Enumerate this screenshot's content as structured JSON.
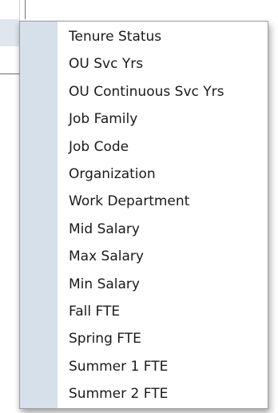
{
  "menu": {
    "items": [
      {
        "label": "Tenure Status"
      },
      {
        "label": "OU Svc Yrs"
      },
      {
        "label": "OU Continuous Svc Yrs"
      },
      {
        "label": "Job Family"
      },
      {
        "label": "Job Code"
      },
      {
        "label": "Organization"
      },
      {
        "label": "Work Department"
      },
      {
        "label": "Mid Salary"
      },
      {
        "label": "Max Salary"
      },
      {
        "label": "Min Salary"
      },
      {
        "label": "Fall FTE"
      },
      {
        "label": "Spring FTE"
      },
      {
        "label": "Summer 1 FTE"
      },
      {
        "label": "Summer 2 FTE"
      }
    ]
  },
  "colors": {
    "gutter": "#d6e0ea",
    "menu_background": "#ffffff",
    "menu_border": "#9c9c9c",
    "text": "#1a1a1a"
  }
}
